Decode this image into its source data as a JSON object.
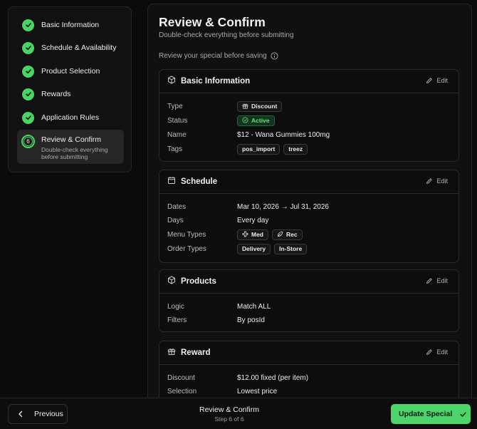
{
  "sidebar": {
    "steps": [
      {
        "label": "Basic Information",
        "state": "complete"
      },
      {
        "label": "Schedule & Availability",
        "state": "complete"
      },
      {
        "label": "Product Selection",
        "state": "complete"
      },
      {
        "label": "Rewards",
        "state": "complete"
      },
      {
        "label": "Application Rules",
        "state": "complete"
      },
      {
        "label": "Review & Confirm",
        "number": "6",
        "description": "Double-check everything before submitting",
        "state": "current"
      }
    ]
  },
  "main": {
    "title": "Review & Confirm",
    "subtitle": "Double-check everything before submitting",
    "review_note": "Review your special before saving",
    "edit_label": "Edit",
    "basic": {
      "title": "Basic Information",
      "type_label": "Type",
      "type_value": "Discount",
      "status_label": "Status",
      "status_value": "Active",
      "name_label": "Name",
      "name_value": "$12 - Wana Gummies 100mg",
      "tags_label": "Tags",
      "tags": [
        "pos_import",
        "treez"
      ]
    },
    "schedule": {
      "title": "Schedule",
      "dates_label": "Dates",
      "dates_value": "Mar 10, 2026 → Jul 31, 2026",
      "days_label": "Days",
      "days_value": "Every day",
      "menu_label": "Menu Types",
      "menu_types": [
        "Med",
        "Rec"
      ],
      "order_label": "Order Types",
      "order_types": [
        "Delivery",
        "In-Store"
      ]
    },
    "products": {
      "title": "Products",
      "logic_label": "Logic",
      "logic_value": "Match ALL",
      "filters_label": "Filters",
      "filters_value": "By posId"
    },
    "reward": {
      "title": "Reward",
      "discount_label": "Discount",
      "discount_value": "$12.00 fixed (per item)",
      "selection_label": "Selection",
      "selection_value": "Lowest price"
    }
  },
  "footer": {
    "previous_label": "Previous",
    "step_title": "Review & Confirm",
    "step_counter": "Step 6 of 6",
    "update_label": "Update Special"
  },
  "colors": {
    "accent": "#4ad466",
    "background": "#0b0b0b",
    "card_border": "#2a2a2a"
  }
}
